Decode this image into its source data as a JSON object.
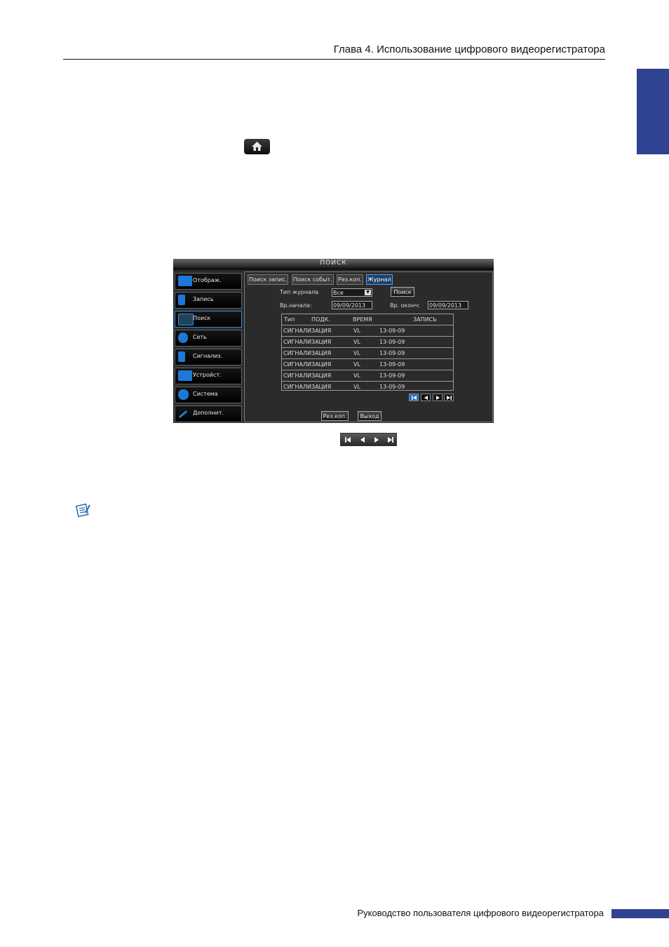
{
  "header": {
    "chapter_title": "Глава 4. Использование цифрового видеорегистратора"
  },
  "colors": {
    "accent": "#2f4390",
    "dvr_highlight": "#1e78d8"
  },
  "icons": {
    "home": "home-icon",
    "note": "note-icon"
  },
  "dvr": {
    "window_title": "ПОИСК",
    "menu": [
      {
        "label": "Отображ.",
        "icon": "monitor-icon"
      },
      {
        "label": "Запись",
        "icon": "record-icon"
      },
      {
        "label": "Поиск",
        "icon": "search-icon",
        "active": true
      },
      {
        "label": "Сеть",
        "icon": "globe-icon"
      },
      {
        "label": "Сигнализ.",
        "icon": "alarm-icon"
      },
      {
        "label": "Устройст.",
        "icon": "device-icon"
      },
      {
        "label": "Система",
        "icon": "gear-icon"
      },
      {
        "label": "Дополнит.",
        "icon": "wrench-icon"
      }
    ],
    "tabs": [
      "Поиск запис.",
      "Поиск событ.",
      "Рез.коп.",
      "Журнал"
    ],
    "active_tab": "Журнал",
    "log_type_label": "Тип журнала",
    "log_type_value": "Все",
    "search_button": "Поиск",
    "start_label": "Вр.начала:",
    "start_value": "09/09/2013",
    "end_label": "Вр. оконч:",
    "end_value": "09/09/2013",
    "table": {
      "headers": [
        "Тип",
        "ПОДК.",
        "ВРЕМЯ",
        "ЗАПИСЬ"
      ],
      "rows": [
        [
          "СИГНАЛИЗАЦИЯ",
          "VL",
          "13-09-09"
        ],
        [
          "СИГНАЛИЗАЦИЯ",
          "VL",
          "13-09-09"
        ],
        [
          "СИГНАЛИЗАЦИЯ",
          "VL",
          "13-09-09"
        ],
        [
          "СИГНАЛИЗАЦИЯ",
          "VL",
          "13-09-09"
        ],
        [
          "СИГНАЛИЗАЦИЯ",
          "VL",
          "13-09-09"
        ],
        [
          "СИГНАЛИЗАЦИЯ",
          "VL",
          "13-09-09"
        ]
      ]
    },
    "backup_button": "Рез.коп.",
    "exit_button": "Выход"
  },
  "footer": {
    "manual_title": "Руководство пользователя цифрового видеорегистратора"
  }
}
